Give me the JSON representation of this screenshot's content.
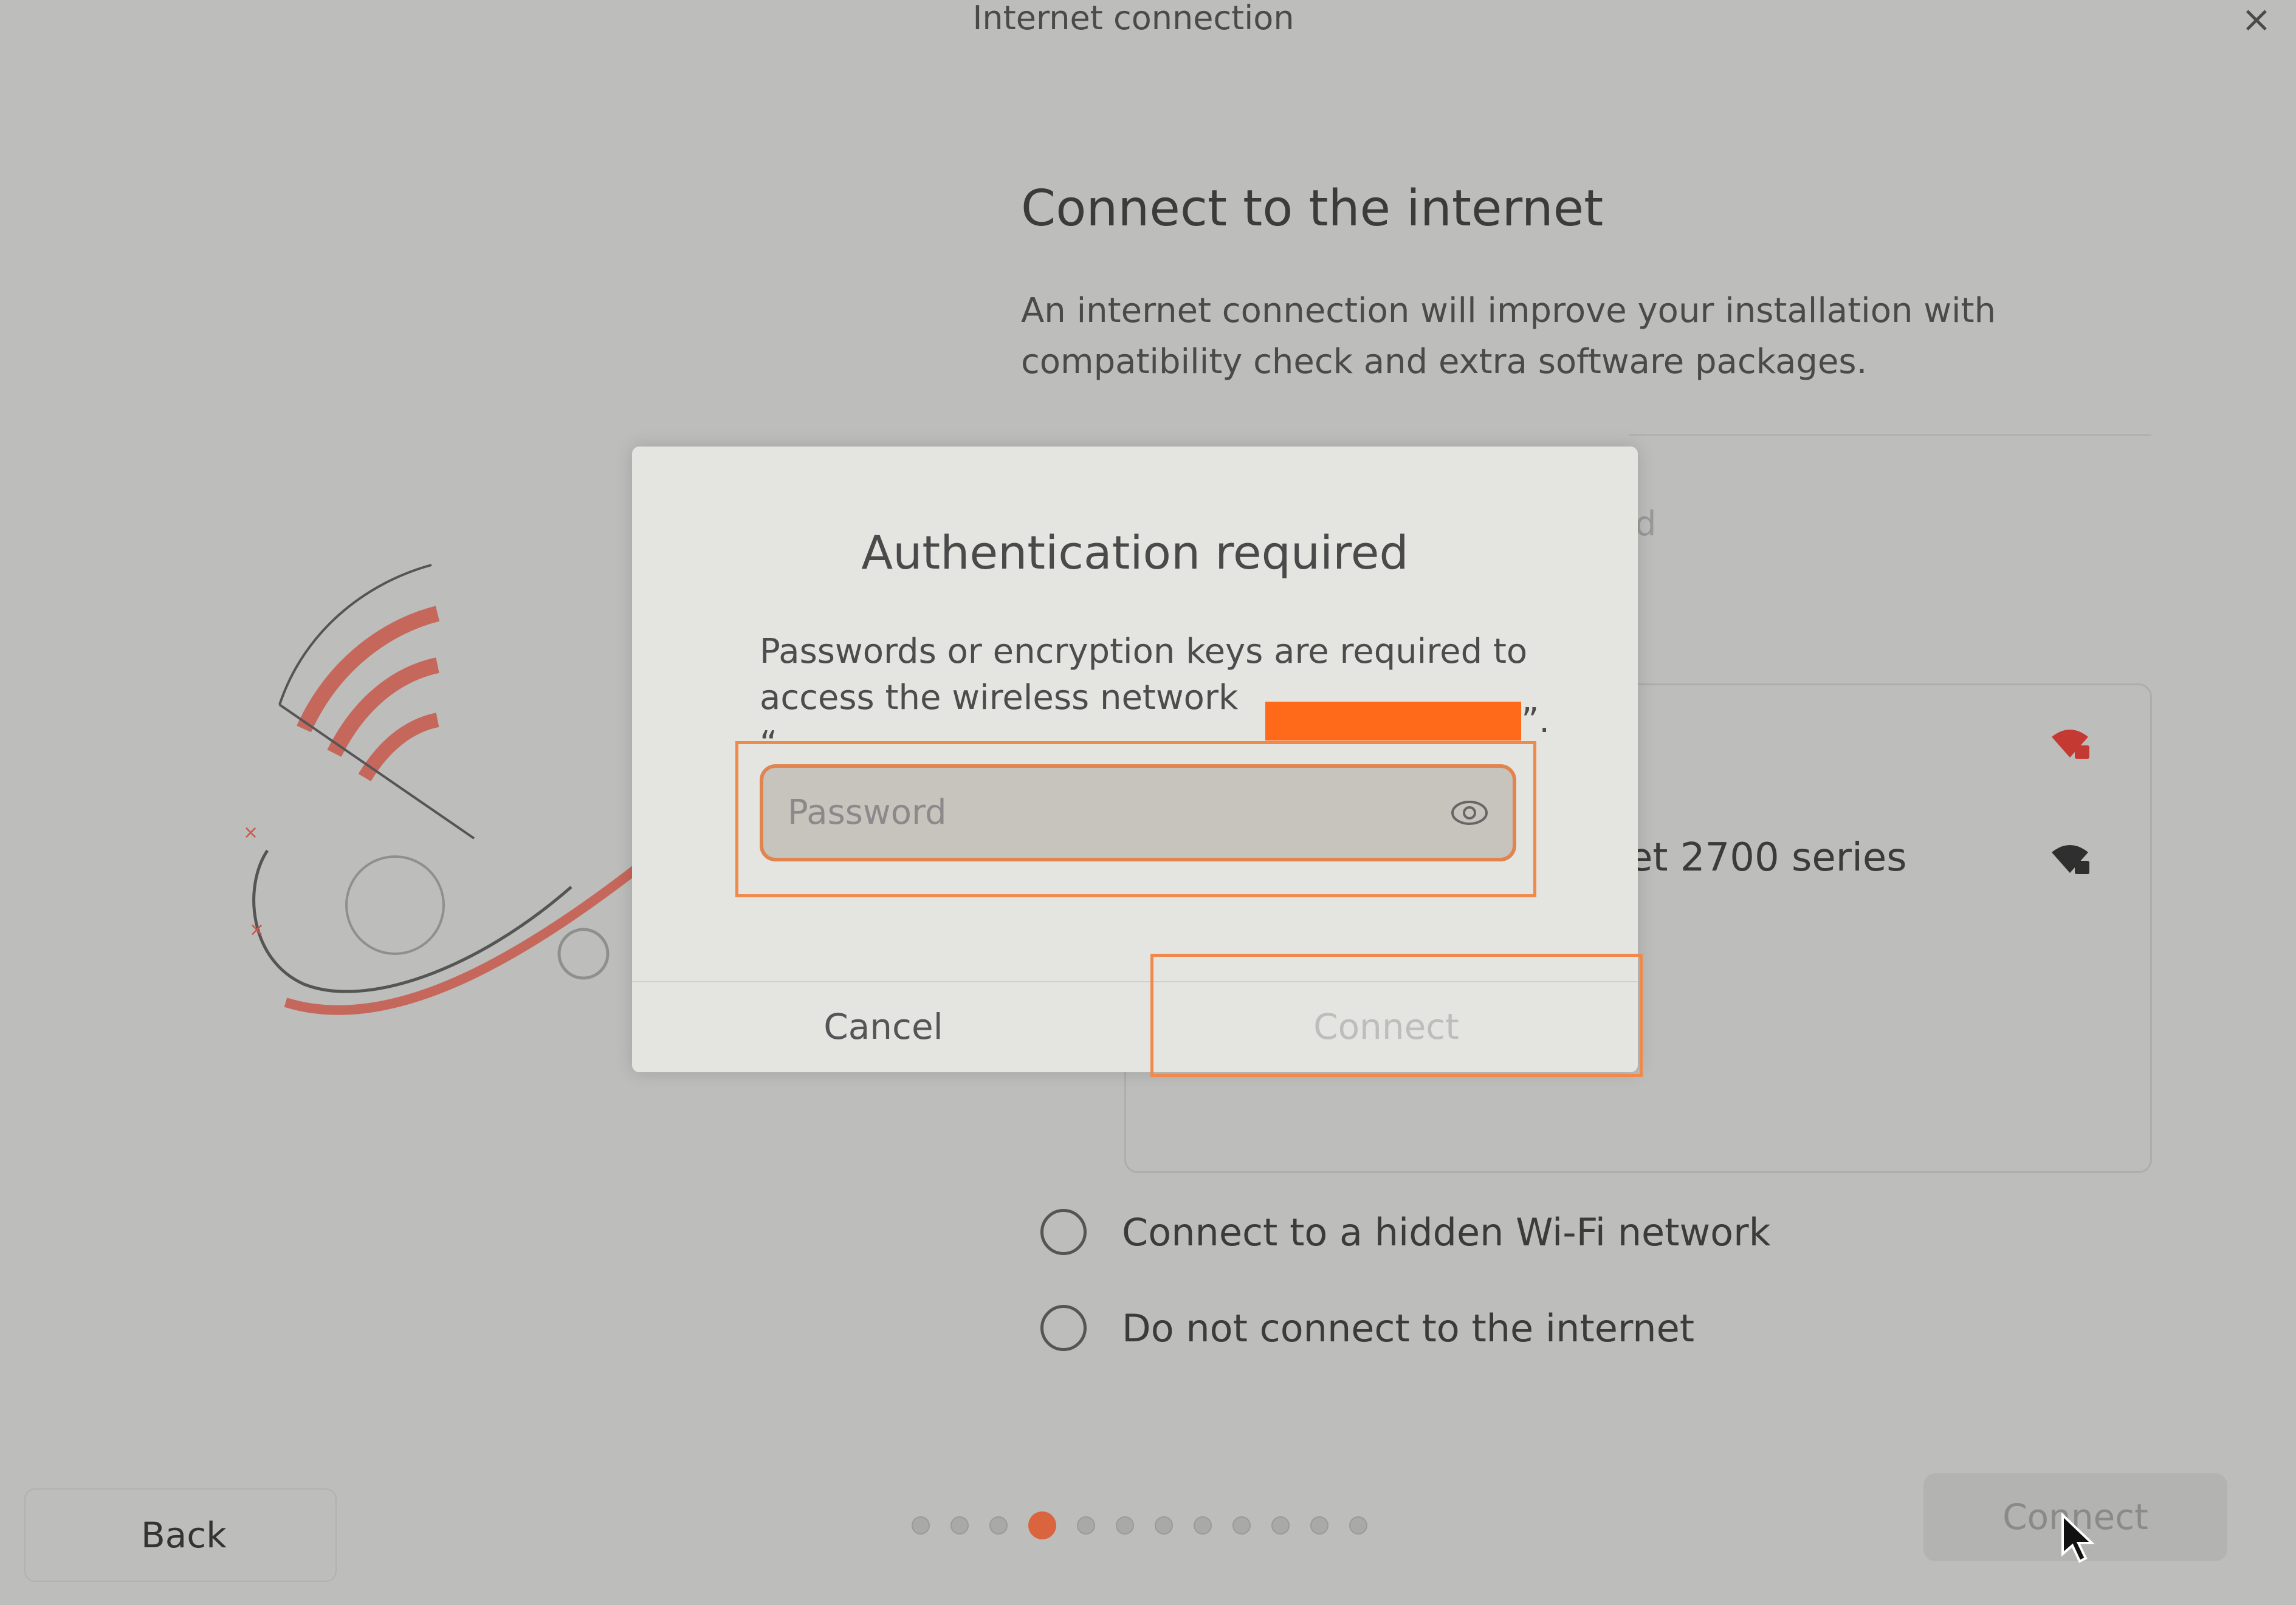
{
  "window": {
    "title": "Internet connection",
    "close_glyph": "×"
  },
  "page": {
    "heading": "Connect to the internet",
    "description": "An internet connection will improve your installation with compatibility check and extra software packages.",
    "partial_header_text": "d",
    "network_row_label": "et 2700 series"
  },
  "options": [
    {
      "label": "Connect to a hidden Wi-Fi network"
    },
    {
      "label": "Do not connect to the internet"
    }
  ],
  "footer": {
    "back_label": "Back",
    "connect_label": "Connect",
    "step_count": 12,
    "active_step": 4
  },
  "dialog": {
    "title": "Authentication required",
    "text_line1": "Passwords or encryption keys are required to",
    "text_line2_prefix": "access the wireless network “",
    "text_line2_suffix": "”.",
    "password_placeholder": "Password",
    "cancel_label": "Cancel",
    "connect_label": "Connect"
  },
  "colors": {
    "accent": "#d9643e",
    "highlight": "#f08a4b",
    "redaction": "#ff6a1a"
  },
  "icons": [
    "close-icon",
    "wifi-locked-icon",
    "eye-icon",
    "mouse-cursor-icon"
  ]
}
